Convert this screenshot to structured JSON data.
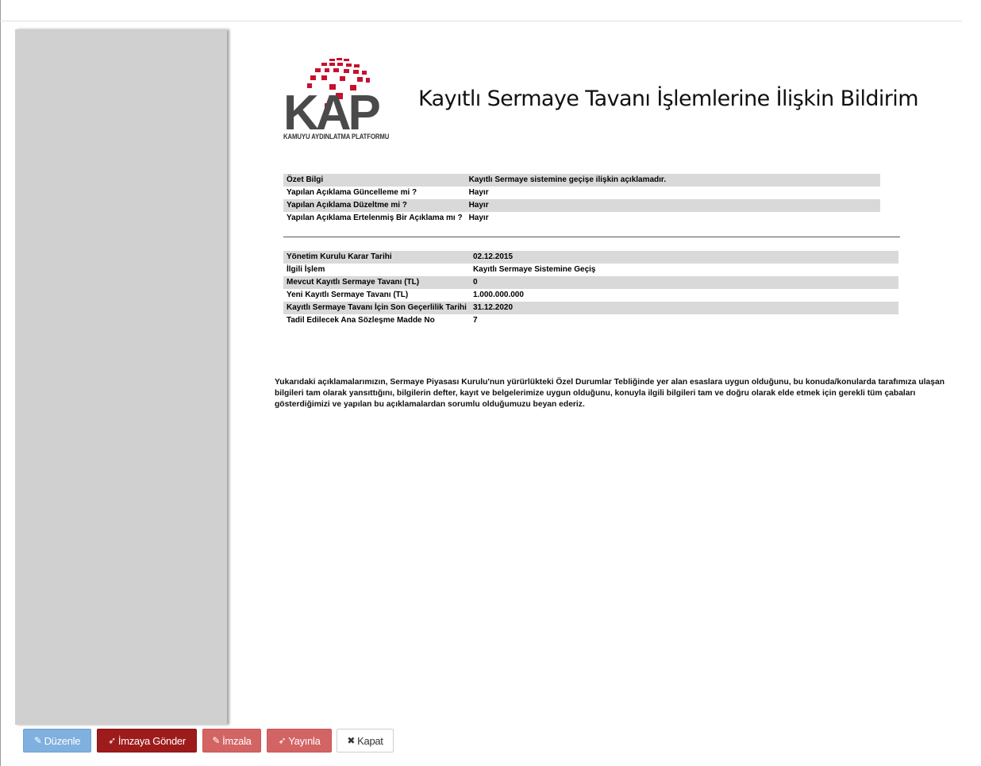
{
  "header": {
    "logo_text": "KAP",
    "logo_caption": "KAMUYU AYDINLATMA PLATFORMU",
    "title": "Kayıtlı Sermaye Tavanı İşlemlerine İlişkin Bildirim"
  },
  "summary_table": [
    {
      "label": "Özet Bilgi",
      "value": "Kayıtlı Sermaye sistemine geçişe ilişkin açıklamadır."
    },
    {
      "label": "Yapılan Açıklama Güncelleme mi ?",
      "value": "Hayır"
    },
    {
      "label": "Yapılan Açıklama Düzeltme mi ?",
      "value": "Hayır"
    },
    {
      "label": "Yapılan Açıklama Ertelenmiş Bir Açıklama mı ?",
      "value": "Hayır"
    }
  ],
  "detail_table": [
    {
      "label": "Yönetim Kurulu Karar Tarihi",
      "value": "02.12.2015"
    },
    {
      "label": "İlgili İşlem",
      "value": "Kayıtlı Sermaye Sistemine Geçiş"
    },
    {
      "label": "Mevcut Kayıtlı Sermaye Tavanı (TL)",
      "value": "0"
    },
    {
      "label": "Yeni Kayıtlı Sermaye Tavanı (TL)",
      "value": "1.000.000.000"
    },
    {
      "label": "Kayıtlı Sermaye Tavanı İçin Son Geçerlilik Tarihi",
      "value": "31.12.2020"
    },
    {
      "label": "Tadil Edilecek Ana Sözleşme Madde No",
      "value": "7"
    }
  ],
  "declaration": "Yukarıdaki açıklamalarımızın, Sermaye Piyasası Kurulu'nun yürürlükteki Özel Durumlar Tebliğinde yer alan esaslara uygun olduğunu, bu konuda/konularda tarafımıza ulaşan bilgileri tam olarak yansıttığını, bilgilerin defter, kayıt ve belgelerimize uygun olduğunu, konuyla ilgili bilgileri tam ve doğru olarak elde etmek için gerekli tüm çabaları gösterdiğimizi ve yapılan bu açıklamalardan sorumlu olduğumuzu beyan ederiz.",
  "toolbar": {
    "edit_label": "Düzenle",
    "send_to_sign_label": "İmzaya Gönder",
    "sign_label": "İmzala",
    "publish_label": "Yayınla",
    "close_label": "Kapat"
  },
  "colors": {
    "edit": "#7fb0de",
    "send_to_sign": "#9e1b1b",
    "sign": "#d36464",
    "publish": "#d36464",
    "logo_red": "#c8102e",
    "logo_gray": "#4a4a4a"
  },
  "icons": {
    "edit": "pencil-icon",
    "send_to_sign": "paper-plane-icon",
    "sign": "pencil-icon",
    "publish": "paper-plane-icon",
    "close": "close-icon"
  }
}
